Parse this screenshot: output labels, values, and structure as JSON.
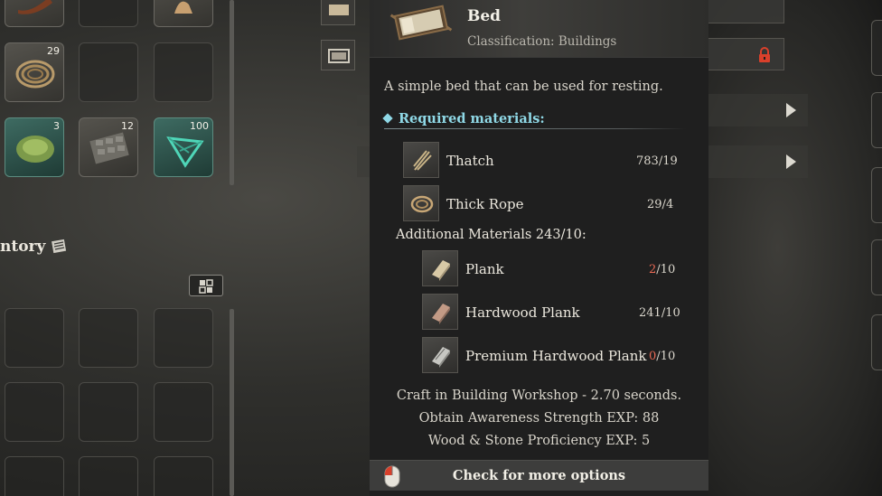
{
  "inventory": {
    "title": "ntory",
    "slots": [
      {
        "count": "29",
        "item": "rope"
      },
      {
        "count": "",
        "item": "empty"
      },
      {
        "count": "",
        "item": "empty"
      },
      {
        "count": "3",
        "item": "green-shell"
      },
      {
        "count": "12",
        "item": "stone-brick"
      },
      {
        "count": "100",
        "item": "crystal"
      }
    ]
  },
  "build_list": {
    "locked_icon": "lock-icon"
  },
  "tooltip": {
    "name": "Bed",
    "classification": "Classification: Buildings",
    "description": "A simple bed that can be used for resting.",
    "required_label": "Required materials:",
    "required": [
      {
        "name": "Thatch",
        "have": "783",
        "sep": "/",
        "need": "19",
        "short": false
      },
      {
        "name": "Thick Rope",
        "have": "29",
        "sep": "/",
        "need": "4",
        "short": false
      }
    ],
    "additional_label": "Additional Materials 243/10:",
    "additional": [
      {
        "name": "Plank",
        "have": "2",
        "sep": "/",
        "need": "10",
        "short": true
      },
      {
        "name": "Hardwood Plank",
        "have": "241",
        "sep": "/",
        "need": "10",
        "short": false
      },
      {
        "name": "Premium Hardwood Plank",
        "have": "0",
        "sep": "/",
        "need": "10",
        "short": true
      }
    ],
    "craft_line": "Craft in Building Workshop - 2.70 seconds.",
    "exp_line": "Obtain Awareness Strength EXP: 88",
    "prof_line": "Wood & Stone Proficiency EXP: 5",
    "more_options": "Check for more options"
  },
  "colors": {
    "accent_cyan": "#8fd8e6",
    "shortage_red": "#e86a55",
    "lock_red": "#d9402b"
  }
}
